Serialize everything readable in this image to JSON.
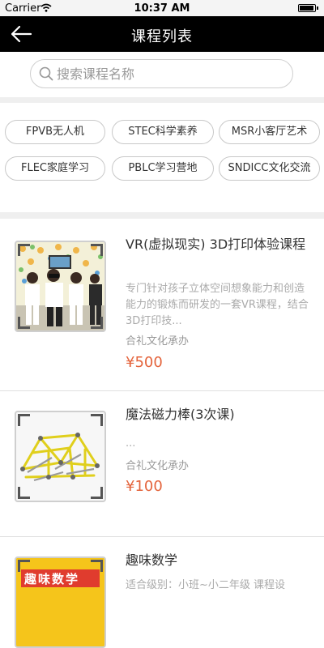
{
  "status": {
    "carrier": "Carrier",
    "time": "10:37 AM"
  },
  "nav": {
    "title": "课程列表"
  },
  "search": {
    "placeholder": "搜索课程名称",
    "value": ""
  },
  "tags": [
    "FPVB无人机",
    "STEC科学素养",
    "MSR小客厅艺术",
    "FLEC家庭学习",
    "PBLC学习营地",
    "SNDICC文化交流"
  ],
  "courses": [
    {
      "title": "VR(虚拟现实) 3D打印体验课程",
      "desc": "专门针对孩子立体空间想象能力和创造能力的锻炼而研发的一套VR课程，结合3D打印技...",
      "org": "合礼文化承办",
      "price": "¥500",
      "image": "vr-kids-photo"
    },
    {
      "title": "魔法磁力棒(3次课)",
      "desc": "...",
      "org": "合礼文化承办",
      "price": "¥100",
      "image": "magnetic-sticks-photo"
    },
    {
      "title": "趣味数学",
      "desc": "适合级别：小班~小二年级 课程设",
      "org": "",
      "price": "",
      "image": "fun-math-book-photo",
      "image_text": "趣味数学"
    }
  ],
  "colors": {
    "nav_bg": "#000000",
    "price": "#e4643c",
    "divider": "#efefef"
  }
}
